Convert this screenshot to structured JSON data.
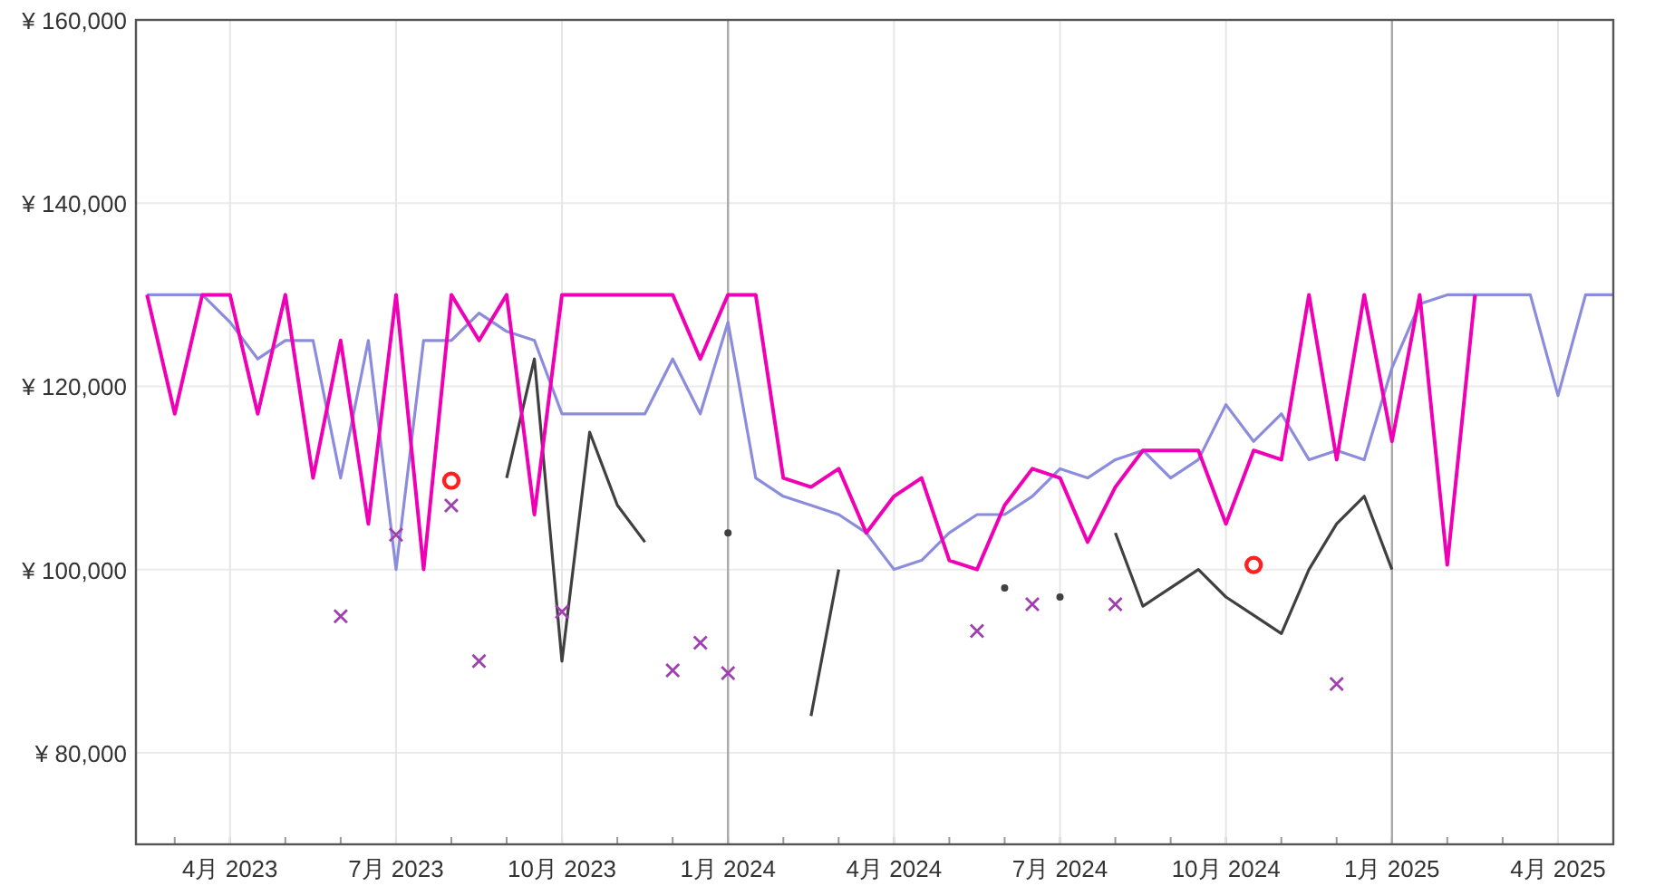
{
  "chart": {
    "chart_data": {
      "type": "line",
      "grid": true,
      "ylim": [
        70000,
        160000
      ],
      "categories": [
        null,
        null,
        null,
        "4月 2023",
        null,
        null,
        null,
        null,
        null,
        "7月 2023",
        null,
        null,
        null,
        null,
        null,
        "10月 2023",
        null,
        null,
        null,
        null,
        null,
        "1月 2024",
        null,
        null,
        null,
        null,
        null,
        "4月 2024",
        null,
        null,
        null,
        null,
        null,
        "7月 2024",
        null,
        null,
        null,
        null,
        null,
        "10月 2024",
        null,
        null,
        null,
        null,
        null,
        "1月 2025",
        null,
        null,
        null,
        null,
        null,
        "4月 2025",
        null,
        null
      ],
      "yticks": [
        {
          "value": 80000,
          "label": "¥ 80,000"
        },
        {
          "value": 100000,
          "label": "¥ 100,000"
        },
        {
          "value": 120000,
          "label": "¥ 120,000"
        },
        {
          "value": 140000,
          "label": "¥ 140,000"
        },
        {
          "value": 160000,
          "label": "¥ 160,000"
        }
      ],
      "series": [
        {
          "type": "line",
          "color": "#8c8cdc",
          "values": [
            130000,
            130000,
            130000,
            127000,
            123000,
            125000,
            125000,
            110000,
            125000,
            100000,
            125000,
            125000,
            128000,
            126000,
            125000,
            117000,
            117000,
            117000,
            117000,
            123000,
            117000,
            127000,
            110000,
            108000,
            107000,
            106000,
            104000,
            100000,
            101000,
            104000,
            106000,
            106000,
            108000,
            111000,
            110000,
            112000,
            113000,
            110000,
            112000,
            118000,
            114000,
            117000,
            112000,
            113000,
            112000,
            122000,
            129000,
            130000,
            130000,
            130000,
            130000,
            119000,
            130000,
            130000
          ]
        },
        {
          "type": "line",
          "color": "#404040",
          "values": [
            null,
            null,
            null,
            null,
            null,
            null,
            null,
            null,
            null,
            null,
            null,
            null,
            null,
            110000,
            123000,
            90000,
            115000,
            107000,
            103000,
            null,
            null,
            104000,
            null,
            null,
            84000,
            100000,
            null,
            null,
            null,
            null,
            null,
            98000,
            null,
            97000,
            null,
            104000,
            96000,
            98000,
            100000,
            97000,
            95000,
            93000,
            100000,
            105000,
            108000,
            100000,
            null,
            null,
            null,
            null,
            null,
            null,
            null,
            null
          ]
        },
        {
          "type": "line",
          "color": "#f000b4",
          "values": [
            130000,
            117000,
            130000,
            130000,
            117000,
            130000,
            110000,
            125000,
            105000,
            130000,
            100000,
            130000,
            125000,
            130000,
            106000,
            130000,
            130000,
            130000,
            130000,
            130000,
            123000,
            130000,
            130000,
            110000,
            109000,
            111000,
            104000,
            108000,
            110000,
            101000,
            100000,
            107000,
            111000,
            110000,
            103000,
            109000,
            113000,
            113000,
            113000,
            105000,
            113000,
            112000,
            130000,
            112000,
            130000,
            114000,
            130000,
            100500,
            130000,
            null,
            null,
            null,
            null,
            null
          ]
        },
        {
          "type": "scatter",
          "color": "#a040b0",
          "values": [
            null,
            null,
            null,
            null,
            null,
            null,
            null,
            94900,
            null,
            103800,
            null,
            107000,
            90000,
            null,
            null,
            95400,
            null,
            null,
            null,
            89000,
            92000,
            88700,
            null,
            null,
            null,
            null,
            null,
            null,
            null,
            null,
            93300,
            null,
            96200,
            null,
            null,
            96200,
            null,
            null,
            null,
            null,
            null,
            null,
            null,
            87500,
            null,
            null,
            null,
            null,
            null,
            null,
            null,
            null,
            null,
            null
          ]
        },
        {
          "type": "scatter",
          "color": "#ff2020",
          "values": [
            null,
            null,
            null,
            null,
            null,
            null,
            null,
            null,
            null,
            null,
            null,
            109700,
            null,
            null,
            null,
            null,
            null,
            null,
            null,
            null,
            null,
            null,
            null,
            null,
            null,
            null,
            null,
            null,
            null,
            null,
            null,
            null,
            null,
            null,
            null,
            null,
            null,
            null,
            null,
            null,
            100500,
            null,
            null,
            null,
            null,
            null,
            null,
            null,
            null,
            null,
            null,
            null,
            null,
            null
          ]
        }
      ]
    }
  }
}
